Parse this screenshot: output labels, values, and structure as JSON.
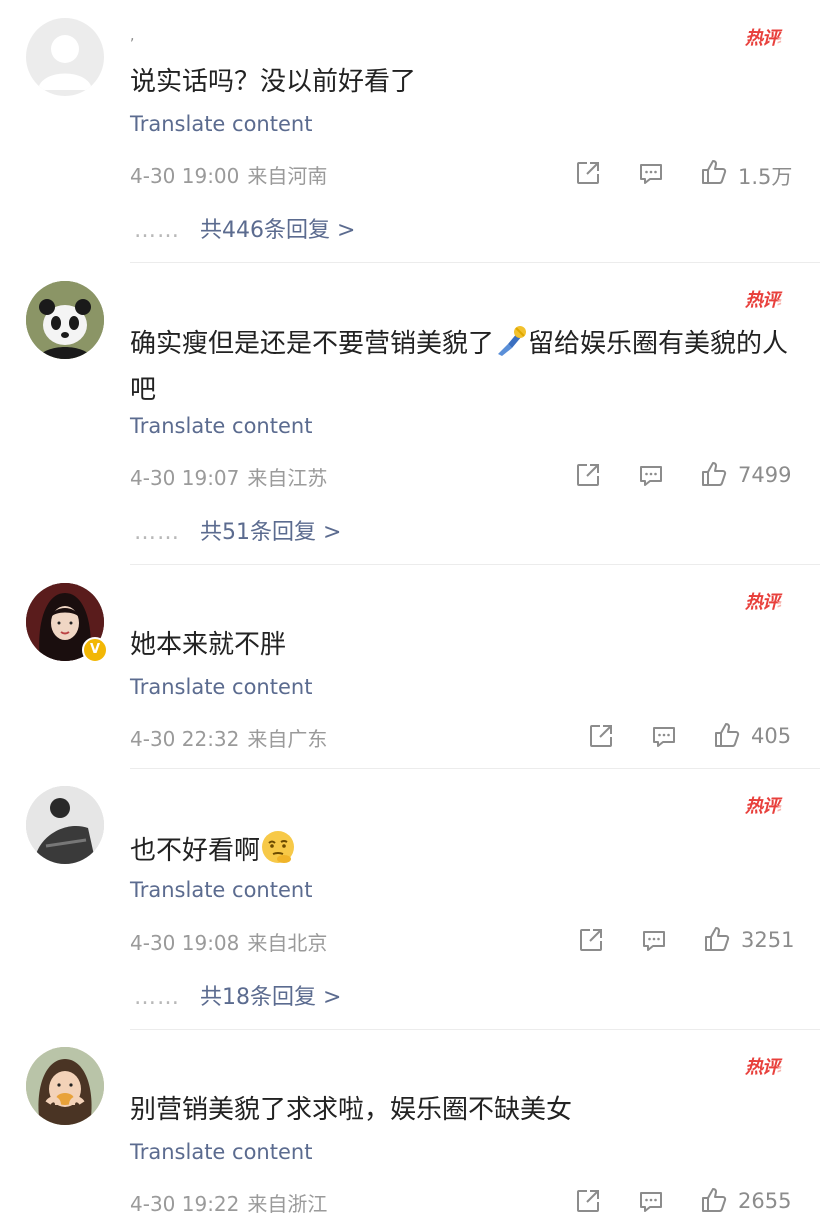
{
  "translate_label": "Translate content",
  "hot_label": "热评",
  "comments": [
    {
      "username": ",",
      "text": "说实话吗？没以前好看了",
      "date": "4-30 19:00",
      "location": "来自河南",
      "likes": "1.5万",
      "replies": "共446条回复 >",
      "avatar": "default-avatar"
    },
    {
      "username": "",
      "text_before_emoji": "确实瘦但是还是不要营销美貌了",
      "emoji": "sweeping-broom-emoji",
      "text_after_emoji": "留给娱乐圈有美貌的人吧",
      "date": "4-30 19:07",
      "location": "来自江苏",
      "likes": "7499",
      "replies": "共51条回复 >",
      "avatar": "panda-avatar"
    },
    {
      "username": "",
      "text": "她本来就不胖",
      "date": "4-30 22:32",
      "location": "来自广东",
      "likes": "405",
      "avatar": "woman-avatar",
      "verified": "V"
    },
    {
      "username": "",
      "text": "也不好看啊",
      "emoji": "thinking-face-emoji",
      "date": "4-30 19:08",
      "location": "来自北京",
      "likes": "3251",
      "replies": "共18条回复 >",
      "avatar": "person-avatar"
    },
    {
      "username": "",
      "text": "别营销美貌了求求啦，娱乐圈不缺美女",
      "date": "4-30 19:22",
      "location": "来自浙江",
      "likes": "2655",
      "avatar": "child-avatar"
    }
  ],
  "colors": {
    "link": "#5b6b8f",
    "hot": "#e8403c",
    "meta": "#9a9a9a",
    "verified": "#f2b705"
  }
}
